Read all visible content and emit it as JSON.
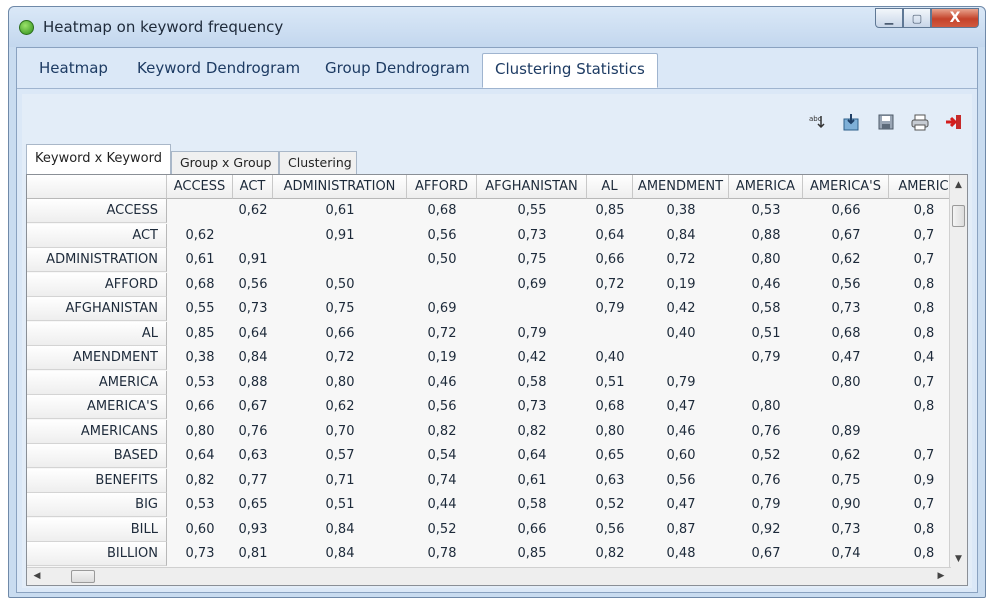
{
  "window": {
    "title": "Heatmap on keyword frequency",
    "close_glyph": "X",
    "min_glyph": "▁",
    "max_glyph": "▢"
  },
  "main_tabs": [
    "Heatmap",
    "Keyword Dendrogram",
    "Group Dendrogram",
    "Clustering Statistics"
  ],
  "toolbar": {
    "icons": [
      "sort-abc-icon",
      "export-icon",
      "save-icon",
      "print-icon",
      "exit-icon"
    ]
  },
  "sub_tabs": [
    "Keyword x Keyword",
    "Group x Group",
    "Clustering"
  ],
  "table": {
    "columns": [
      "ACCESS",
      "ACT",
      "ADMINISTRATION",
      "AFFORD",
      "AFGHANISTAN",
      "AL",
      "AMENDMENT",
      "AMERICA",
      "AMERICA'S",
      "AMERIC"
    ],
    "rows": [
      {
        "label": "ACCESS",
        "values": [
          "",
          "0,62",
          "0,61",
          "0,68",
          "0,55",
          "0,85",
          "0,38",
          "0,53",
          "0,66",
          "0,8"
        ]
      },
      {
        "label": "ACT",
        "values": [
          "0,62",
          "",
          "0,91",
          "0,56",
          "0,73",
          "0,64",
          "0,84",
          "0,88",
          "0,67",
          "0,7"
        ]
      },
      {
        "label": "ADMINISTRATION",
        "values": [
          "0,61",
          "0,91",
          "",
          "0,50",
          "0,75",
          "0,66",
          "0,72",
          "0,80",
          "0,62",
          "0,7"
        ]
      },
      {
        "label": "AFFORD",
        "values": [
          "0,68",
          "0,56",
          "0,50",
          "",
          "0,69",
          "0,72",
          "0,19",
          "0,46",
          "0,56",
          "0,8"
        ]
      },
      {
        "label": "AFGHANISTAN",
        "values": [
          "0,55",
          "0,73",
          "0,75",
          "0,69",
          "",
          "0,79",
          "0,42",
          "0,58",
          "0,73",
          "0,8"
        ]
      },
      {
        "label": "AL",
        "values": [
          "0,85",
          "0,64",
          "0,66",
          "0,72",
          "0,79",
          "",
          "0,40",
          "0,51",
          "0,68",
          "0,8"
        ]
      },
      {
        "label": "AMENDMENT",
        "values": [
          "0,38",
          "0,84",
          "0,72",
          "0,19",
          "0,42",
          "0,40",
          "",
          "0,79",
          "0,47",
          "0,4"
        ]
      },
      {
        "label": "AMERICA",
        "values": [
          "0,53",
          "0,88",
          "0,80",
          "0,46",
          "0,58",
          "0,51",
          "0,79",
          "",
          "0,80",
          "0,7"
        ]
      },
      {
        "label": "AMERICA'S",
        "values": [
          "0,66",
          "0,67",
          "0,62",
          "0,56",
          "0,73",
          "0,68",
          "0,47",
          "0,80",
          "",
          "0,8"
        ]
      },
      {
        "label": "AMERICANS",
        "values": [
          "0,80",
          "0,76",
          "0,70",
          "0,82",
          "0,82",
          "0,80",
          "0,46",
          "0,76",
          "0,89",
          ""
        ]
      },
      {
        "label": "BASED",
        "values": [
          "0,64",
          "0,63",
          "0,57",
          "0,54",
          "0,64",
          "0,65",
          "0,60",
          "0,52",
          "0,62",
          "0,7"
        ]
      },
      {
        "label": "BENEFITS",
        "values": [
          "0,82",
          "0,77",
          "0,71",
          "0,74",
          "0,61",
          "0,63",
          "0,56",
          "0,76",
          "0,75",
          "0,9"
        ]
      },
      {
        "label": "BIG",
        "values": [
          "0,53",
          "0,65",
          "0,51",
          "0,44",
          "0,58",
          "0,52",
          "0,47",
          "0,79",
          "0,90",
          "0,7"
        ]
      },
      {
        "label": "BILL",
        "values": [
          "0,60",
          "0,93",
          "0,84",
          "0,52",
          "0,66",
          "0,56",
          "0,87",
          "0,92",
          "0,73",
          "0,8"
        ]
      },
      {
        "label": "BILLION",
        "values": [
          "0,73",
          "0,81",
          "0,84",
          "0,78",
          "0,85",
          "0,82",
          "0,48",
          "0,67",
          "0,74",
          "0,8"
        ]
      }
    ]
  }
}
